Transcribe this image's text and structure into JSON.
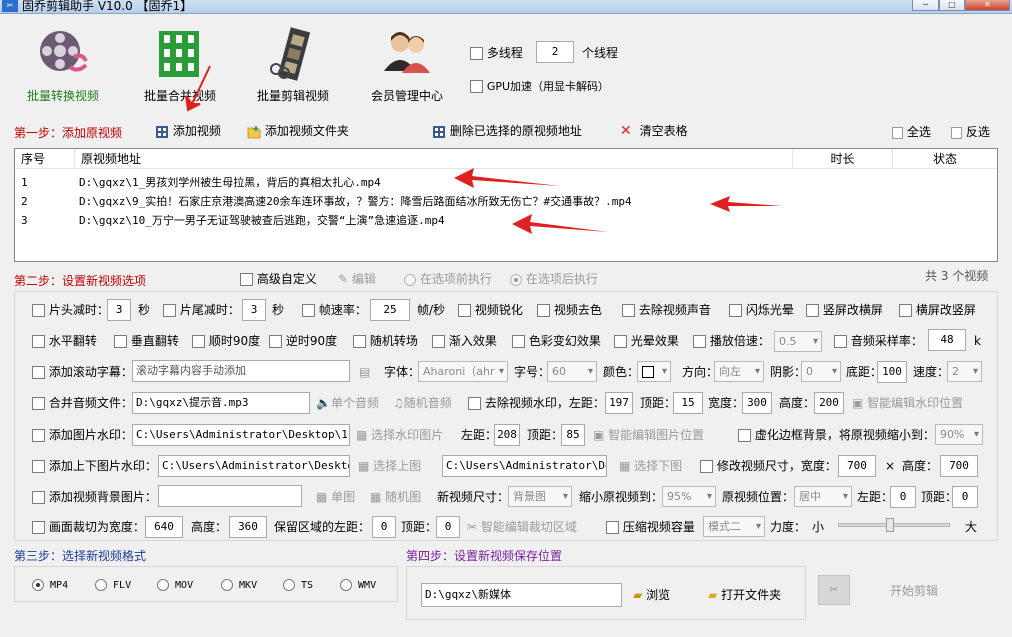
{
  "window": {
    "title": "固乔剪辑助手 V10.0 【固乔1】",
    "min": "─",
    "max": "□",
    "close": "✕"
  },
  "top_tools": [
    {
      "label": "批量转换视频",
      "color": "#1f7d1f"
    },
    {
      "label": "批量合并视频",
      "color": "#000000"
    },
    {
      "label": "批量剪辑视频",
      "color": "#000000"
    },
    {
      "label": "会员管理中心",
      "color": "#000000"
    }
  ],
  "threads": {
    "label": "多线程",
    "value": "2",
    "unit": "个线程"
  },
  "gpu": {
    "label": "GPU加速（用显卡解码）"
  },
  "step1": {
    "title": "第一步：添加原视频",
    "add_video": "添加视频",
    "add_folder": "添加视频文件夹",
    "delete_selected": "删除已选择的原视频地址",
    "clear_table": "清空表格",
    "select_all": "全选",
    "invert": "反选"
  },
  "table": {
    "columns": [
      "序号",
      "原视频地址",
      "时长",
      "状态"
    ],
    "rows": [
      {
        "no": "1",
        "path": "D:\\gqxz\\1_男孩刘学州被生母拉黑，背后的真相太扎心.mp4",
        "duration": "",
        "status": ""
      },
      {
        "no": "2",
        "path": "D:\\gqxz\\9_实拍！石家庄京港澳高速20余车连环事故，？警方：降雪后路面结冰所致无伤亡？#交通事故？.mp4",
        "duration": "",
        "status": ""
      },
      {
        "no": "3",
        "path": "D:\\gqxz\\10_万宁一男子无证驾驶被查后逃跑，交警“上演”急速追逐.mp4",
        "duration": "",
        "status": ""
      }
    ]
  },
  "step2": {
    "title": "第二步：设置新视频选项",
    "advanced": "高级自定义",
    "edit": "编辑",
    "before": "在选项前执行",
    "after": "在选项后执行",
    "count": "共 3 个视频"
  },
  "opts": {
    "head_cut": "片头减时：",
    "head_val": "3",
    "sec1": "秒",
    "tail_cut": "片尾减时：",
    "tail_val": "3",
    "sec2": "秒",
    "framerate": "帧速率：",
    "framerate_val": "25",
    "fps_unit": "帧/秒",
    "sharpen": "视频锐化",
    "decolor": "视频去色",
    "remove_audio": "去除视频声音",
    "flash": "闪烁光晕",
    "v2h": "竖屏改横屏",
    "h2v": "横屏改竖屏",
    "hflip": "水平翻转",
    "vflip": "垂直翻转",
    "rot90": "顺时90度",
    "rot_ccw": "逆时90度",
    "random_trans": "随机转场",
    "fade_in": "渐入效果",
    "color_fx": "色彩变幻效果",
    "halo": "光晕效果",
    "speed": "播放倍速：",
    "speed_val": "0.5",
    "sample_rate": "音频采样率：",
    "sample_val": "48",
    "sample_unit": "k",
    "scroll_sub": "添加滚动字幕：",
    "scroll_placeholder": "滚动字幕内容手动添加",
    "font": "字体：",
    "font_val": "Aharoni（ahr",
    "size": "字号：",
    "size_val": "60",
    "color": "颜色：",
    "direction": "方向：",
    "direction_val": "向左",
    "shadow": "阴影：",
    "shadow_val": "0",
    "bottom": "底距：",
    "bottom_val": "100",
    "speed2": "速度：",
    "speed2_val": "2",
    "merge_audio": "合并音频文件：",
    "audio_path": "D:\\gqxz\\提示音.mp3",
    "single_audio": "单个音频",
    "random_audio": "随机音频",
    "remove_wm": "去除视频水印，左距：",
    "wm_left": "197",
    "wm_top_lbl": "顶距：",
    "wm_top": "15",
    "wm_w_lbl": "宽度：",
    "wm_w": "300",
    "wm_h_lbl": "高度：",
    "wm_h": "200",
    "smart_wm": "智能编辑水印位置",
    "img_wm": "添加图片水印：",
    "img_path": "C:\\Users\\Administrator\\Desktop\\111.j",
    "select_wm_img": "选择水印图片",
    "img_left_lbl": "左距：",
    "img_left": "208",
    "img_top_lbl": "顶距：",
    "img_top": "85",
    "smart_img": "智能编辑图片位置",
    "blur_bg": "虚化边框背景，将原视频缩小到：",
    "blur_val": "90%",
    "updown_wm": "添加上下图片水印：",
    "up_path": "C:\\Users\\Administrator\\Desktop\\i",
    "select_up": "选择上图",
    "down_path": "C:\\Users\\Administrator\\Desk",
    "select_down": "选择下图",
    "resize": "修改视频尺寸，宽度：",
    "resize_w": "700",
    "times": "×",
    "resize_h_lbl": "高度：",
    "resize_h": "700",
    "bg_img": "添加视频背景图片：",
    "bg_path": "",
    "single_img": "单图",
    "random_img": "随机图",
    "new_size": "新视频尺寸：",
    "new_size_val": "背景图",
    "shrink": "缩小原视频到：",
    "shrink_val": "95%",
    "orig_pos": "原视频位置：",
    "orig_pos_val": "居中",
    "pos_left_lbl": "左距：",
    "pos_left": "0",
    "pos_top_lbl": "顶距：",
    "pos_top": "0",
    "crop": "画面裁切为宽度：",
    "crop_w": "640",
    "crop_h_lbl": "高度：",
    "crop_h": "360",
    "keep_left": "保留区域的左距：",
    "keep_left_val": "0",
    "keep_top_lbl": "顶距：",
    "keep_top_val": "0",
    "smart_crop": "智能编辑裁切区域",
    "compress": "压缩视频容量",
    "mode_val": "模式二",
    "strength": "力度：",
    "small": "小",
    "big": "大"
  },
  "step3": {
    "title": "第三步：选择新视频格式",
    "formats": [
      "MP4",
      "FLV",
      "MOV",
      "MKV",
      "TS",
      "WMV"
    ],
    "selected": "MP4"
  },
  "step4": {
    "title": "第四步：设置新视频保存位置",
    "path": "D:\\gqxz\\新媒体",
    "browse": "浏览",
    "open_folder": "打开文件夹",
    "start": "开始剪辑"
  }
}
